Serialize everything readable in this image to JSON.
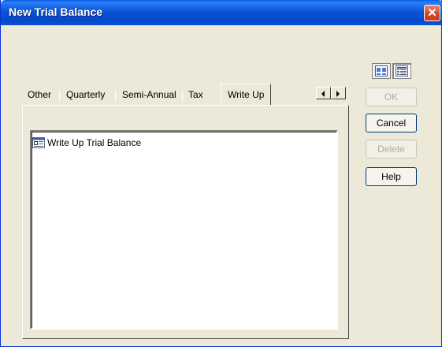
{
  "window": {
    "title": "New Trial Balance",
    "close_glyph": "✕"
  },
  "view_buttons": [
    {
      "icon": "large-icons-view-icon",
      "selected": false
    },
    {
      "icon": "details-view-icon",
      "selected": true
    }
  ],
  "tabs": [
    {
      "label": "Other",
      "selected": false
    },
    {
      "label": "Quarterly",
      "selected": false
    },
    {
      "label": "Semi-Annual",
      "selected": false
    },
    {
      "label": "Tax",
      "selected": false
    },
    {
      "label": "Write Up",
      "selected": true
    }
  ],
  "list": {
    "items": [
      {
        "label": "Write Up Trial Balance",
        "icon": "document-template-icon"
      }
    ]
  },
  "buttons": {
    "ok": {
      "label": "OK",
      "enabled": false
    },
    "cancel": {
      "label": "Cancel",
      "enabled": true
    },
    "delete": {
      "label": "Delete",
      "enabled": false
    },
    "help": {
      "label": "Help",
      "enabled": true
    }
  },
  "colors": {
    "titlebar": "#0a55d8",
    "dialog_face": "#ece9d8",
    "close_button": "#d2452a"
  }
}
